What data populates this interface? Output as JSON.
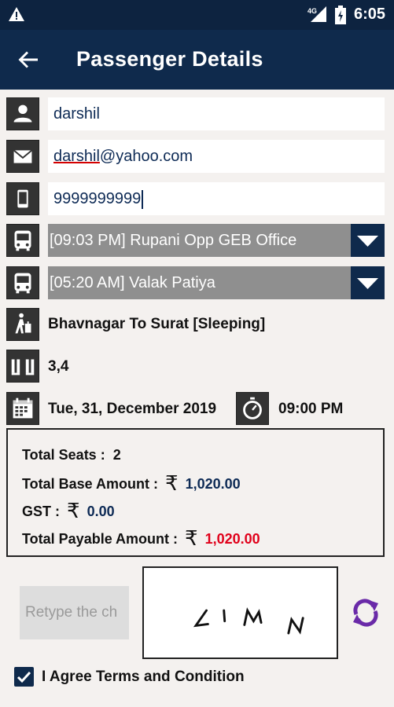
{
  "status_bar": {
    "network": "4G",
    "time": "6:05",
    "warning_icon": "warning-icon",
    "signal_icon": "signal-icon",
    "battery_icon": "battery-charging-icon"
  },
  "app_bar": {
    "title": "Passenger Details",
    "back_icon": "arrow-back-icon"
  },
  "form": {
    "name": {
      "icon": "person-icon",
      "value": "darshil"
    },
    "email": {
      "icon": "mail-icon",
      "value_local": "darshil",
      "value_domain": "@yahoo.com"
    },
    "phone": {
      "icon": "mobile-phone-icon",
      "value": "9999999999"
    },
    "boarding": {
      "icon": "bus-icon",
      "selected": "[09:03 PM] Rupani Opp GEB Office"
    },
    "dropping": {
      "icon": "bus-icon",
      "selected": "[05:20 AM] Valak Patiya"
    }
  },
  "trip": {
    "route_icon": "traveler-icon",
    "route": "Bhavnagar To Surat [Sleeping]",
    "seats_icon": "seats-icon",
    "seats": "3,4",
    "date_icon": "calendar-icon",
    "date": "Tue, 31, December 2019",
    "time_icon": "stopwatch-icon",
    "time": "09:00 PM"
  },
  "fare": {
    "total_seats_label": "Total Seats :",
    "total_seats": "2",
    "base_label": "Total Base Amount :",
    "currency": "₹",
    "base_amount": "1,020.00",
    "gst_label": "GST :",
    "gst_amount": "0.00",
    "payable_label": "Total Payable Amount :",
    "payable_amount": "1,020.00"
  },
  "captcha": {
    "placeholder": "Retype the ch",
    "refresh_icon": "refresh-icon",
    "image_text": "LIMN"
  },
  "agree": {
    "checked": true,
    "label": "I Agree Terms and Condition"
  },
  "colors": {
    "primary": "#0f2a4c",
    "status_bar": "#0d2340",
    "select_bg": "#8f8f8f",
    "accent_purple": "#6a2aa8",
    "payable_red": "#e0001a",
    "value_blue": "#0d2a55"
  }
}
